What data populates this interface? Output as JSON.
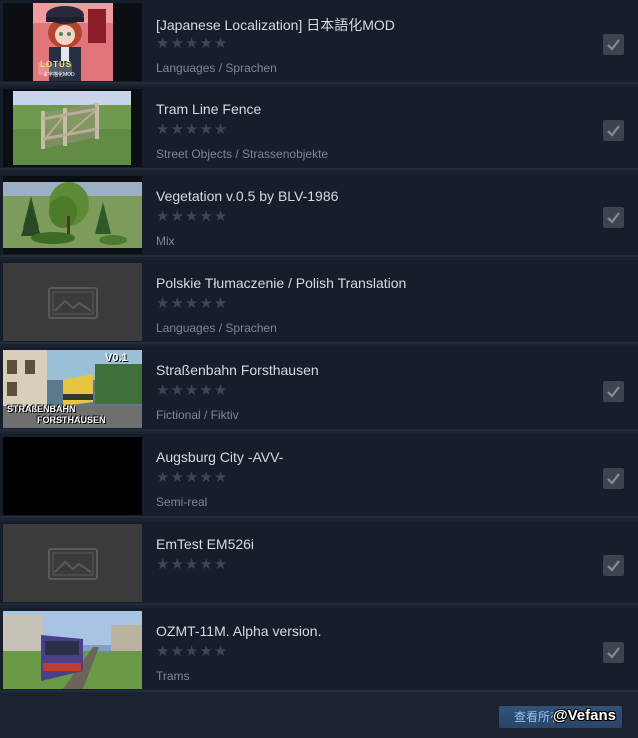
{
  "items": [
    {
      "title": "[Japanese Localization] 日本語化MOD",
      "category": "Languages / Sprachen",
      "rating": "★★★★★",
      "checked": true,
      "thumb_text": "LOTUS",
      "thumb_caption": "よ字描化MOD"
    },
    {
      "title": "Tram Line Fence",
      "category": "Street Objects / Strassenobjekte",
      "rating": "★★★★★",
      "checked": true
    },
    {
      "title": "Vegetation v.0.5 by BLV-1986",
      "category": "Mix",
      "rating": "★★★★★",
      "checked": true
    },
    {
      "title": "Polskie Tłumaczenie / Polish Translation",
      "category": "Languages / Sprachen",
      "rating": "★★★★★",
      "checked": false
    },
    {
      "title": "Straßenbahn Forsthausen",
      "category": "Fictional / Fiktiv",
      "rating": "★★★★★",
      "checked": true,
      "thumb_text": "V0.1",
      "thumb_caption_1": "STRAßENBAHN",
      "thumb_caption_2": "FORSTHAUSEN"
    },
    {
      "title": "Augsburg City -AVV-",
      "category": "Semi-real",
      "rating": "★★★★★",
      "checked": true
    },
    {
      "title": "EmTest EM526i",
      "category": "",
      "rating": "★★★★★",
      "checked": true
    },
    {
      "title": "OZMT-11M. Alpha version.",
      "category": "Trams",
      "rating": "★★★★★",
      "checked": true
    }
  ],
  "footer": {
    "view_button_label": "查看所有"
  },
  "watermark": "@Vefans",
  "colors": {
    "background": "#1b2331",
    "row": "#161e2b",
    "title": "#d6dbe1",
    "category": "#7d8896",
    "star": "#3b4656",
    "checkbox": "#3c4450",
    "button": "#2f4c71"
  }
}
